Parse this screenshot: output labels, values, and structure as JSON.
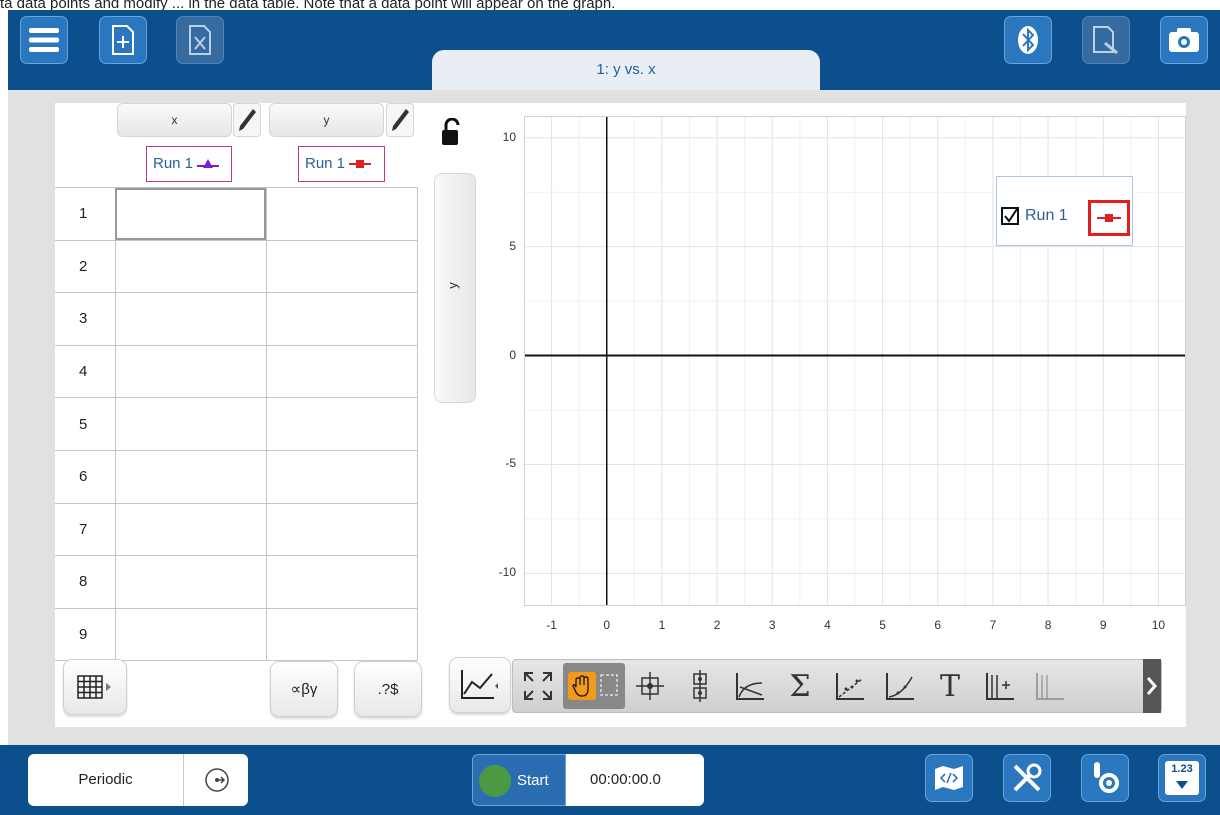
{
  "instruction_text": "ta data points and modify ... in the data table. Note that a data point will appear on the graph.",
  "top_toolbar": {
    "menu_icon": "hamburger-menu-icon",
    "new_file_icon": "new-file-icon",
    "close_file_icon": "close-file-icon",
    "bluetooth_icon": "bluetooth-icon",
    "annotate_icon": "draw-annotate-icon",
    "camera_icon": "camera-icon"
  },
  "tab": {
    "label": "1: y vs. x"
  },
  "table": {
    "columns": [
      {
        "name": "x",
        "run": "Run 1",
        "marker_color": "#7a1fd6",
        "marker": "triangle"
      },
      {
        "name": "y",
        "run": "Run 1",
        "marker_color": "#e02020",
        "marker": "square"
      }
    ],
    "rows": [
      "1",
      "2",
      "3",
      "4",
      "5",
      "6",
      "7",
      "8",
      "9"
    ],
    "cells": [
      [
        "",
        ""
      ],
      [
        "",
        ""
      ],
      [
        "",
        ""
      ],
      [
        "",
        ""
      ],
      [
        "",
        ""
      ],
      [
        "",
        ""
      ],
      [
        "",
        ""
      ],
      [
        "",
        ""
      ],
      [
        "",
        ""
      ]
    ]
  },
  "y_axis_tab": {
    "label": "y"
  },
  "graph": {
    "x_ticks": [
      "-1",
      "0",
      "1",
      "2",
      "3",
      "4",
      "5",
      "6",
      "7",
      "8",
      "9",
      "10"
    ],
    "y_ticks": [
      "10",
      "5",
      "0",
      "-5",
      "-10"
    ],
    "legend": {
      "label": "Run 1",
      "checked": true,
      "color": "#e02020"
    }
  },
  "bottom_left_buttons": {
    "table_options_icon": "table-grid-icon",
    "symbols_label": "∝βγ",
    "units_label": ".?$"
  },
  "graph_tools": {
    "icons": [
      "autoscale-icon",
      "pan-tool-icon",
      "select-tool-icon",
      "examine-icon",
      "interpolate-icon",
      "tangent-icon",
      "statistics-icon",
      "linear-fit-icon",
      "curve-fit-icon",
      "annotation-text-icon",
      "add-column-icon",
      "more-icon"
    ]
  },
  "bottombar": {
    "mode_label": "Periodic",
    "start_label": "Start",
    "timer": "00:00:00.0",
    "calc_label": "1.23"
  }
}
